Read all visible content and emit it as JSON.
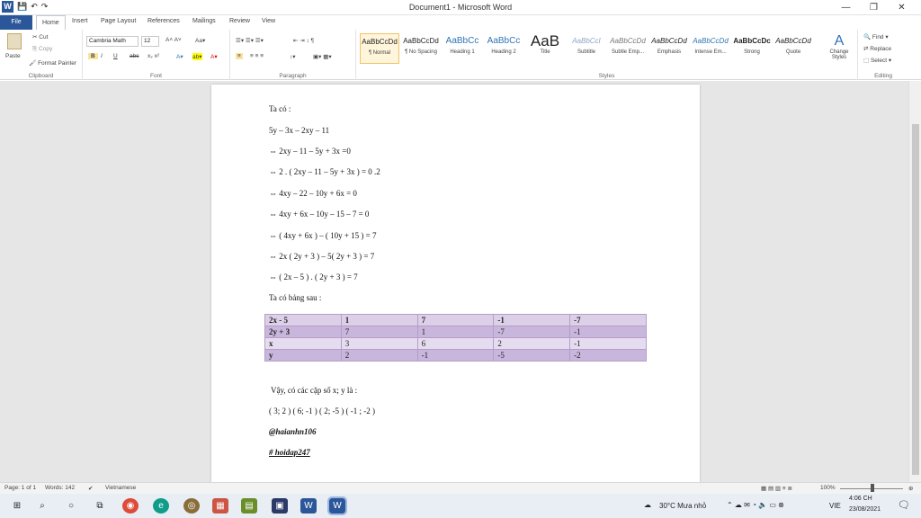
{
  "window": {
    "title": "Document1 - Microsoft Word",
    "logo": "W"
  },
  "qat": {
    "icons": [
      "word-icon",
      "save-icon",
      "undo-icon",
      "redo-icon"
    ]
  },
  "tabs": [
    "File",
    "Home",
    "Insert",
    "Page Layout",
    "References",
    "Mailings",
    "Review",
    "View"
  ],
  "clipboard": {
    "paste": "Paste",
    "cut": "Cut",
    "copy": "Copy",
    "format_painter": "Format Painter",
    "label": "Clipboard"
  },
  "font": {
    "name": "Cambria Math",
    "size": "12",
    "label": "Font"
  },
  "paragraph": {
    "label": "Paragraph"
  },
  "styles": {
    "label": "Styles",
    "items": [
      {
        "sample": "AaBbCcDd",
        "name": "¶ Normal"
      },
      {
        "sample": "AaBbCcDd",
        "name": "¶ No Spacing"
      },
      {
        "sample": "AaBbCc",
        "name": "Heading 1"
      },
      {
        "sample": "AaBbCc",
        "name": "Heading 2"
      },
      {
        "sample": "AaB",
        "name": "Title"
      },
      {
        "sample": "AaBbCcI",
        "name": "Subtitle"
      },
      {
        "sample": "AaBbCcDd",
        "name": "Subtle Emp..."
      },
      {
        "sample": "AaBbCcDd",
        "name": "Emphasis"
      },
      {
        "sample": "AaBbCcDd",
        "name": "Intense Em..."
      },
      {
        "sample": "AaBbCcDc",
        "name": "Strong"
      },
      {
        "sample": "AaBbCcDd",
        "name": "Quote"
      }
    ],
    "change_styles": "Change Styles"
  },
  "editing": {
    "find": "Find",
    "replace": "Replace",
    "select": "Select",
    "label": "Editing"
  },
  "doc": {
    "lines": [
      "Ta có :",
      "5y – 3x – 2xy – 11",
      "⇔ 2xy – 11 – 5y + 3x =0",
      "⇔ 2 . ( 2xy – 11 – 5y + 3x ) = 0 .2",
      "⇔ 4xy – 22 – 10y + 6x = 0",
      "⇔ 4xy + 6x – 10y – 15 – 7 = 0",
      "⇔ ( 4xy + 6x ) – ( 10y + 15 ) = 7",
      "⇔ 2x ( 2y + 3 ) – 5( 2y + 3 ) = 7",
      "⇔ ( 2x – 5 ) . ( 2y + 3 ) = 7",
      "Ta có bảng sau :"
    ],
    "table": [
      [
        "2x - 5",
        "1",
        "7",
        "-1",
        "-7"
      ],
      [
        "2y + 3",
        "7",
        "1",
        "-7",
        "-1"
      ],
      [
        "x",
        "3",
        "6",
        "2",
        "-1"
      ],
      [
        "y",
        "2",
        "-1",
        "-5",
        "-2"
      ]
    ],
    "conclusion": "Vậy, có các cặp số x; y là :",
    "pairs": "( 3; 2 )     ( 6; -1 )    ( 2; -5 )   ( -1 ; -2 )",
    "signature": "@haianhn106",
    "hashtag": "# hoidap247"
  },
  "status": {
    "page": "Page: 1 of 1",
    "words": "Words: 142",
    "lang": "Vietnamese",
    "zoom": "100%"
  },
  "taskbar": {
    "weather": "30°C  Mưa nhỏ",
    "lang": "VIE",
    "time": "4:06 CH",
    "date": "23/08/2021"
  }
}
